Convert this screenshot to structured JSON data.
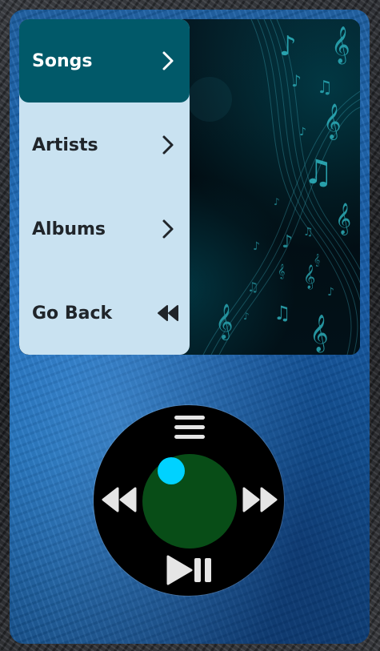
{
  "menu": {
    "items": [
      {
        "label": "Songs",
        "icon": "chevron-right-icon",
        "active": true
      },
      {
        "label": "Artists",
        "icon": "chevron-right-icon",
        "active": false
      },
      {
        "label": "Albums",
        "icon": "chevron-right-icon",
        "active": false
      },
      {
        "label": "Go Back",
        "icon": "rewind-icon",
        "active": false
      }
    ]
  },
  "controls": {
    "menu_icon": "hamburger-menu-icon",
    "previous_icon": "rewind-icon",
    "next_icon": "fast-forward-icon",
    "play_pause_icon": "play-pause-icon"
  },
  "colors": {
    "active_item": "#015969",
    "menu_background": "#c9e2f1",
    "wheel": "#000000",
    "wheel_center": "#084d17",
    "indicator": "#00d2ff",
    "body": "#1a6cc0"
  }
}
